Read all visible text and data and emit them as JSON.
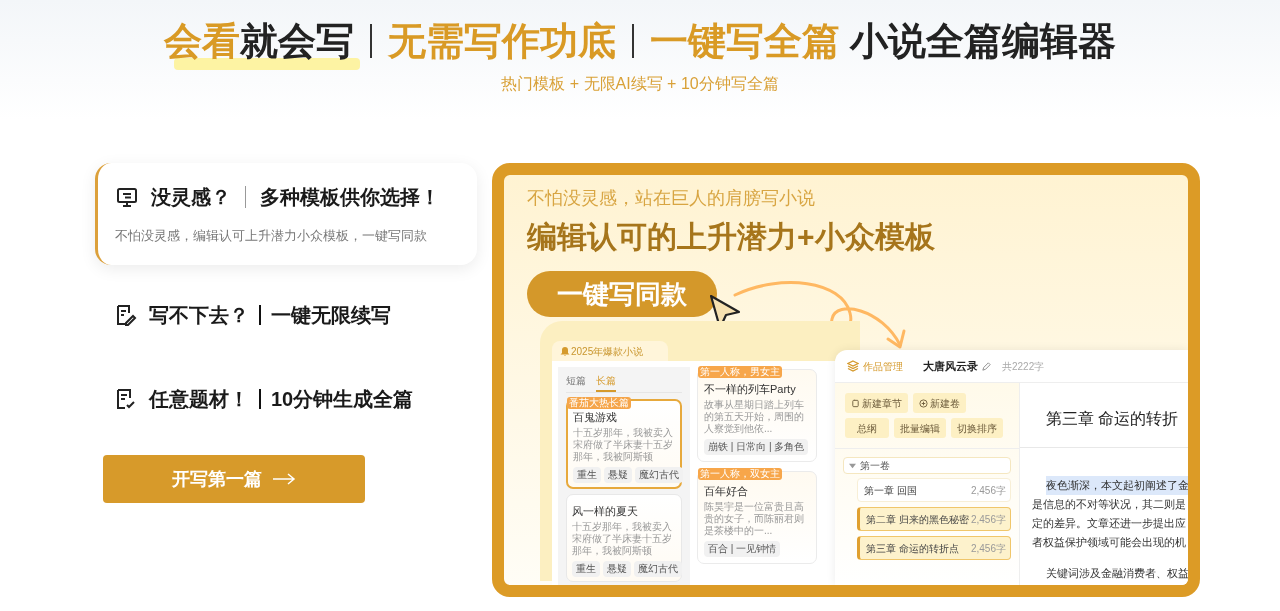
{
  "hero": {
    "title_groups": [
      {
        "highlighted": true,
        "parts": [
          {
            "text": "会看",
            "accent": true
          },
          {
            "text": "就会写",
            "accent": false
          }
        ]
      },
      {
        "highlighted": false,
        "parts": [
          {
            "text": "无需写作功底",
            "accent": true
          }
        ]
      },
      {
        "highlighted": false,
        "parts": [
          {
            "text": "一键写全篇",
            "accent": true
          },
          {
            "text": " 小说全篇编辑器",
            "accent": false
          }
        ]
      }
    ],
    "subtitle": "热门模板 + 无限AI续写 + 10分钟写全篇"
  },
  "features": [
    {
      "title": "没灵感？",
      "tagline": "多种模板供你选择！",
      "description": "不怕没灵感，编辑认可上升潜力小众模板，一键写同款",
      "selected": true
    },
    {
      "title": "写不下去？",
      "tagline": "一键无限续写",
      "selected": false
    },
    {
      "title": "任意题材！",
      "tagline": "10分钟生成全篇",
      "selected": false
    }
  ],
  "cta_button": {
    "label": "开写第一篇"
  },
  "showcase": {
    "kicker": "不怕没灵感，站在巨人的肩膀写小说",
    "headline": "编辑认可的上升潜力+小众模板",
    "pill_button": "一键写同款",
    "template_panel": {
      "title": "2025年爆款小说",
      "tabs": [
        {
          "label": "短篇",
          "selected": false
        },
        {
          "label": "长篇",
          "selected": true
        }
      ],
      "side_cards": [
        {
          "badge": "番茄大热长篇",
          "title": "百鬼游戏",
          "excerpt": "十五岁那年，我被卖入宋府做了半床妻十五岁那年，我被阿斯顿",
          "tags": [
            "重生",
            "悬疑",
            "魔幻古代"
          ],
          "selected": true
        },
        {
          "title": "风一样的夏天",
          "excerpt": "十五岁那年，我被卖入宋府做了半床妻十五岁那年，我被阿斯顿",
          "tags": [
            "重生",
            "悬疑",
            "魔幻古代"
          ],
          "selected": false
        }
      ],
      "grid_cards": [
        {
          "badge": "第一人称，男女主",
          "title": "不一样的列车Party",
          "excerpt": "故事从星期日踏上列车的第五天开始，周围的人察觉到他依...",
          "tags": "崩铁 | 日常向 | 多角色"
        },
        {
          "badge": "第一人称，双女主",
          "title": "百年好合",
          "excerpt": "陈昊宇是一位富贵且高贵的女子，而陈丽君则是茶楼中的一...",
          "tags": "百合 | 一见钟情"
        }
      ]
    },
    "editor": {
      "nav_label": "作品管理",
      "book_title": "大唐风云录",
      "word_count": "共2222字",
      "toolbar_buttons": [
        "新建章节",
        "新建卷",
        "总纲",
        "批量编辑",
        "切换排序"
      ],
      "volume": {
        "label": "第一卷",
        "expanded": true,
        "chapters": [
          {
            "title": "第一章 回国",
            "words": "2,456字",
            "selected": false
          },
          {
            "title": "第二章 归来的黑色秘密",
            "words": "2,456字",
            "selected": true
          },
          {
            "title": "第三章 命运的转折点",
            "words": "2,456字",
            "selected": true
          }
        ]
      },
      "chapter_heading": "第三章 命运的转折",
      "paragraphs": [
        {
          "lines": [
            {
              "text": "夜色渐深，本文起初阐述了金",
              "selected": true
            },
            {
              "text": "是信息的不对等状况，其二则是",
              "selected": false
            },
            {
              "text": "定的差异。文章还进一步提出应",
              "selected": false
            },
            {
              "text": "者权益保护领域可能会出现的机",
              "selected": false
            }
          ]
        },
        {
          "lines": [
            {
              "text": "关键词涉及金融消费者、权益",
              "selected": false
            }
          ]
        }
      ]
    }
  }
}
